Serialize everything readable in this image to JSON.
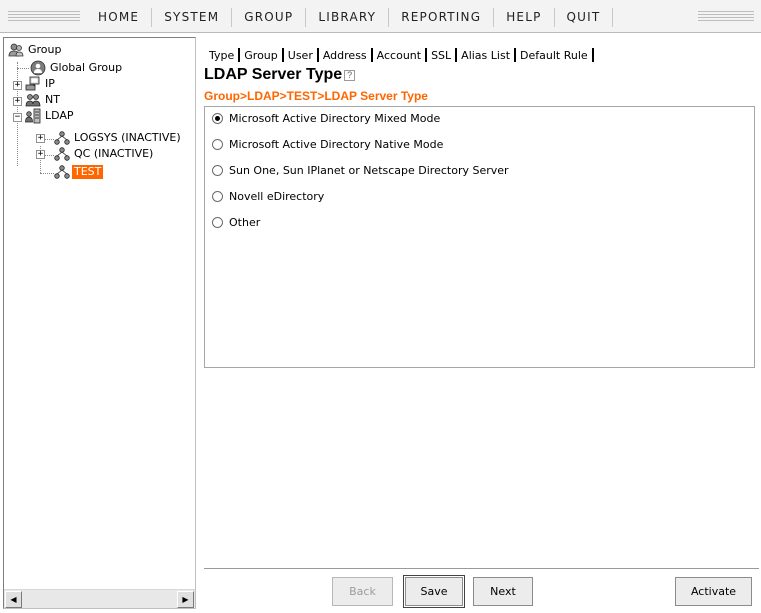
{
  "menu": {
    "items": [
      "HOME",
      "SYSTEM",
      "GROUP",
      "LIBRARY",
      "REPORTING",
      "HELP",
      "QUIT"
    ]
  },
  "tree": {
    "root": "Group",
    "global_group": "Global Group",
    "ip": "IP",
    "nt": "NT",
    "ldap": "LDAP",
    "ldap_children": [
      "LOGSYS (INACTIVE)",
      "QC (INACTIVE)",
      "TEST"
    ],
    "selected": "TEST"
  },
  "tabs": [
    "Type",
    "Group",
    "User",
    "Address",
    "Account",
    "SSL",
    "Alias List",
    "Default Rule"
  ],
  "page": {
    "title": "LDAP Server Type",
    "help_icon": "?",
    "breadcrumb": "Group>LDAP>TEST>LDAP Server Type"
  },
  "server_types": {
    "options": [
      "Microsoft Active Directory Mixed Mode",
      "Microsoft Active Directory Native Mode",
      "Sun One, Sun IPlanet or Netscape Directory Server",
      "Novell eDirectory",
      "Other"
    ],
    "selected_index": 0
  },
  "buttons": {
    "back": "Back",
    "save": "Save",
    "next": "Next",
    "activate": "Activate"
  },
  "icons": {
    "group": "group-icon",
    "global_group": "global-group-icon",
    "ip": "network-computer-icon",
    "nt": "users-icon",
    "ldap": "directory-server-icon",
    "ldap_server": "ldap-server-node-icon"
  },
  "colors": {
    "accent": "#ff6600",
    "selected_bg": "#ff6600"
  }
}
